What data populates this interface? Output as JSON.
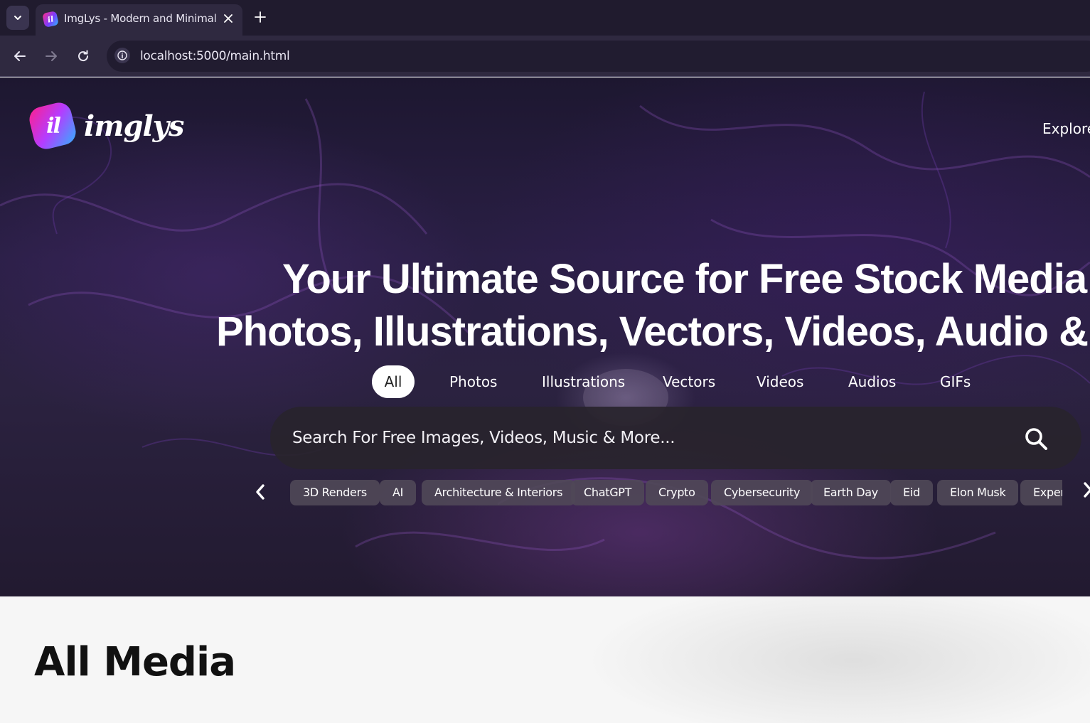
{
  "browser": {
    "tab_title": "ImgLys - Modern and Minimal",
    "url": "localhost:5000/main.html"
  },
  "site": {
    "logo_text": "imglys",
    "logo_mark": "il",
    "nav": {
      "explore": "Explore"
    }
  },
  "hero": {
    "headline_line1": "Your Ultimate Source for Free Stock Media:",
    "headline_line2": "Photos, Illustrations, Vectors, Videos, Audio & GIFs",
    "media_tabs": [
      "All",
      "Photos",
      "Illustrations",
      "Vectors",
      "Videos",
      "Audios",
      "GIFs"
    ],
    "active_tab": "All",
    "search": {
      "placeholder": "Search For Free Images, Videos, Music & More...",
      "value": ""
    },
    "chips": [
      "3D Renders",
      "AI",
      "Architecture & Interiors",
      "ChatGPT",
      "Crypto",
      "Cybersecurity",
      "Earth Day",
      "Eid",
      "Elon Musk",
      "Exper"
    ]
  },
  "content": {
    "section_title": "All Media"
  },
  "colors": {
    "tabstrip": "#201b2e",
    "toolbar": "#2f2940",
    "logo_gradient_start": "#ff1f8c",
    "logo_gradient_end": "#2fb3ff"
  }
}
